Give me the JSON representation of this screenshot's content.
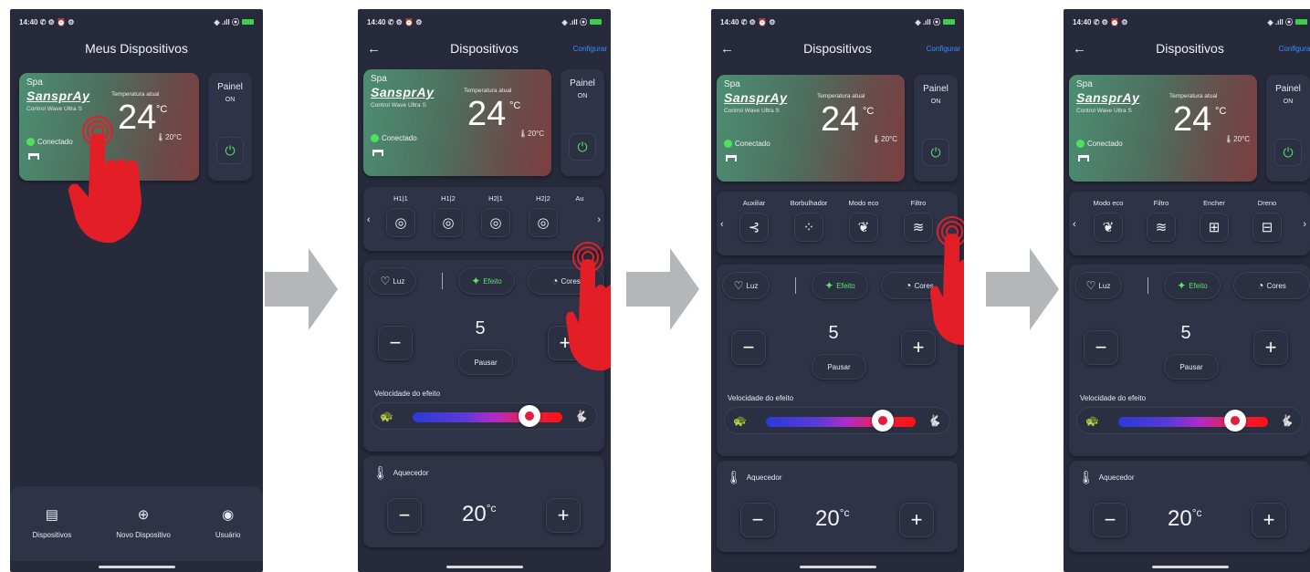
{
  "status": {
    "time": "14:40",
    "icons": "✆ ⚙ ⏰ ⚙",
    "right": "◈ .ıll ⦿"
  },
  "screen1": {
    "title": "Meus Dispositivos",
    "spa": {
      "label": "Spa",
      "brand": "SansprAy",
      "model": "Control Wave Ultra S",
      "temp_label": "Temperatura atual",
      "temp": "24",
      "unit": "°C",
      "setpoint": "🌡20°C",
      "status": "Conectado"
    },
    "painel": {
      "label": "Painel",
      "state": "ON"
    },
    "nav": [
      {
        "label": "Dispositivos",
        "icon": "▤"
      },
      {
        "label": "Novo Dispositivo",
        "icon": "⊕"
      },
      {
        "label": "Usuário",
        "icon": "◉"
      }
    ]
  },
  "screen": {
    "title": "Dispositivos",
    "configure": "Configurar",
    "back": "←",
    "spa": {
      "label": "Spa",
      "brand": "SansprAy",
      "model": "Control Wave Ultra S",
      "temp_label": "Temperatura atual",
      "temp": "24",
      "unit": "°C",
      "setpoint": "🌡20°C",
      "status": "Conectado"
    },
    "painel": {
      "label": "Painel",
      "state": "ON",
      "power_icon": "⏻"
    },
    "lights": {
      "luz": "Luz",
      "efeito": "Efeito",
      "cores": "Cores"
    },
    "effect_number": "5",
    "pausar": "Pausar",
    "minus": "−",
    "plus": "+",
    "speed_label": "Velocidade do efeito",
    "speed_value": 0.78,
    "aquecedor": {
      "label": "Aquecedor",
      "temp": "20",
      "unit": "°c"
    }
  },
  "carousel2": [
    {
      "label": "H1|1",
      "icon": "◎"
    },
    {
      "label": "H1|2",
      "icon": "◎"
    },
    {
      "label": "H2|1",
      "icon": "◎"
    },
    {
      "label": "H2|2",
      "icon": "◎"
    },
    {
      "label": "Au",
      "icon": "✣"
    }
  ],
  "carousel3": [
    {
      "label": "Auxiliar",
      "icon": "⊰"
    },
    {
      "label": "Borbulhador",
      "icon": "⁘"
    },
    {
      "label": "Modo eco",
      "icon": "❦"
    },
    {
      "label": "Filtro",
      "icon": "≋"
    }
  ],
  "carousel4": [
    {
      "label": "Modo eco",
      "icon": "❦"
    },
    {
      "label": "Filtro",
      "icon": "≋"
    },
    {
      "label": "Encher",
      "icon": "⊞"
    },
    {
      "label": "Dreno",
      "icon": "⊟"
    }
  ],
  "colors": {
    "bg": "#262a3b",
    "card": "#2e3347",
    "accent_green": "#4fe05d",
    "link_blue": "#3d8bff",
    "hand_red": "#e41e26",
    "arrow_gray": "#b4b6b9"
  }
}
